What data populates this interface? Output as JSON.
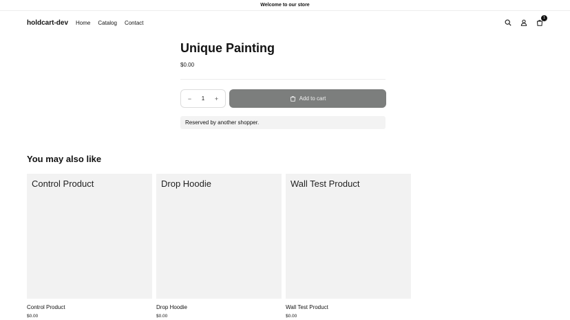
{
  "announcement": "Welcome to our store",
  "header": {
    "logo": "holdcart-dev",
    "nav": [
      "Home",
      "Catalog",
      "Contact"
    ],
    "cart_count": "1"
  },
  "product": {
    "title": "Unique Painting",
    "price": "$0.00",
    "quantity": "1",
    "add_to_cart_label": "Add to cart",
    "reserved_note": "Reserved by another shopper."
  },
  "related": {
    "heading": "You may also like",
    "items": [
      {
        "image_label": "Control Product",
        "title": "Control Product",
        "price": "$0.00"
      },
      {
        "image_label": "Drop Hoodie",
        "title": "Drop Hoodie",
        "price": "$0.00"
      },
      {
        "image_label": "Wall Test Product",
        "title": "Wall Test Product",
        "price": "$0.00"
      }
    ]
  },
  "colors": {
    "button_bg": "#7c7e7d",
    "reserved_bg": "#f3f3f3",
    "card_bg": "#f2f2f2"
  }
}
